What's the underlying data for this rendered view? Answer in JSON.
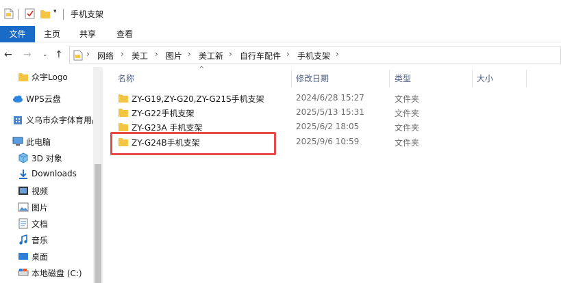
{
  "window": {
    "title": "手机支架"
  },
  "ribbon": {
    "tabs": [
      "文件",
      "主页",
      "共享",
      "查看"
    ]
  },
  "address": {
    "crumbs": [
      "网络",
      "美工",
      "图片",
      "美工新",
      "自行车配件",
      "手机支架"
    ]
  },
  "sidebar": {
    "items": [
      {
        "label": "众宇Logo",
        "icon": "folder-icon"
      },
      {
        "label": "WPS云盘",
        "icon": "cloud-icon"
      },
      {
        "label": "义乌市众宇体育用品",
        "icon": "building-icon"
      },
      {
        "label": "此电脑",
        "icon": "computer-icon"
      },
      {
        "label": "3D 对象",
        "icon": "cube-icon"
      },
      {
        "label": "Downloads",
        "icon": "download-icon"
      },
      {
        "label": "视频",
        "icon": "video-icon"
      },
      {
        "label": "图片",
        "icon": "picture-icon"
      },
      {
        "label": "文档",
        "icon": "document-icon"
      },
      {
        "label": "音乐",
        "icon": "music-icon"
      },
      {
        "label": "桌面",
        "icon": "desktop-icon"
      },
      {
        "label": "本地磁盘 (C:)",
        "icon": "drive-icon"
      }
    ]
  },
  "columns": {
    "name": "名称",
    "date": "修改日期",
    "type": "类型",
    "size": "大小"
  },
  "files": [
    {
      "name": "ZY-G19,ZY-G20,ZY-G21S手机支架",
      "date": "2024/6/28 15:27",
      "type": "文件夹"
    },
    {
      "name": "ZY-G22手机支架",
      "date": "2025/5/13 15:31",
      "type": "文件夹"
    },
    {
      "name": "ZY-G23A 手机支架",
      "date": "2025/6/2 18:05",
      "type": "文件夹"
    },
    {
      "name": "ZY-G24B手机支架",
      "date": "2025/9/6 10:59",
      "type": "文件夹"
    }
  ],
  "colors": {
    "accent": "#1a6ac8",
    "folder": "#f4c542",
    "highlight": "#e84a4a"
  }
}
